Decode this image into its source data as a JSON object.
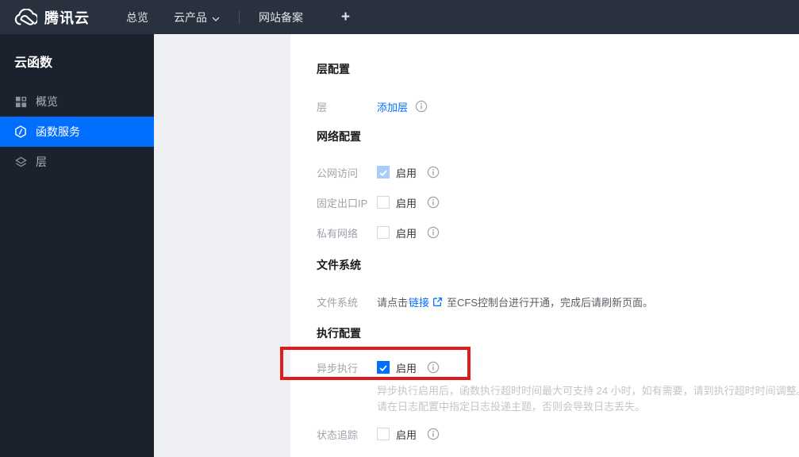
{
  "topnav": {
    "brand": "腾讯云",
    "overview": "总览",
    "cloud_products": "云产品",
    "website_filing": "网站备案",
    "plus": "+"
  },
  "sidebar": {
    "title": "云函数",
    "items": [
      {
        "label": "概览",
        "icon": "grid-icon",
        "active": false
      },
      {
        "label": "函数服务",
        "icon": "function-hexagon-icon",
        "active": true
      },
      {
        "label": "层",
        "icon": "layers-icon",
        "active": false
      }
    ]
  },
  "sections": {
    "layer_config": {
      "title": "层配置",
      "layer_label": "层",
      "add_layer_link": "添加层"
    },
    "network_config": {
      "title": "网络配置",
      "rows": [
        {
          "label": "公网访问",
          "enable": "启用",
          "checked": true,
          "disabled": true
        },
        {
          "label": "固定出口IP",
          "enable": "启用",
          "checked": false,
          "disabled": false
        },
        {
          "label": "私有网络",
          "enable": "启用",
          "checked": false,
          "disabled": false
        }
      ]
    },
    "file_system": {
      "title": "文件系统",
      "label": "文件系统",
      "text_before": "请点击",
      "link_text": "链接",
      "text_after": "至CFS控制台进行开通，完成后请刷新页面。"
    },
    "execution_config": {
      "title": "执行配置",
      "async": {
        "label": "异步执行",
        "enable": "启用",
        "checked": true,
        "desc_line1": "异步执行启用后，函数执行超时时间最大可支持 24 小时，如有需要，请到执行超时时间调整。",
        "desc_line2": "请在日志配置中指定日志投递主题，否则会导致日志丢失。"
      },
      "status_tracking": {
        "label": "状态追踪",
        "enable": "启用",
        "checked": false
      }
    }
  },
  "colors": {
    "accent_blue": "#006eff",
    "annotation_red": "#e01b1b",
    "topnav_bg": "#29313f",
    "sidebar_bg": "#1c222d",
    "panel_gray": "#eef0f3",
    "disabled_check_blue": "#a9cdf8"
  }
}
